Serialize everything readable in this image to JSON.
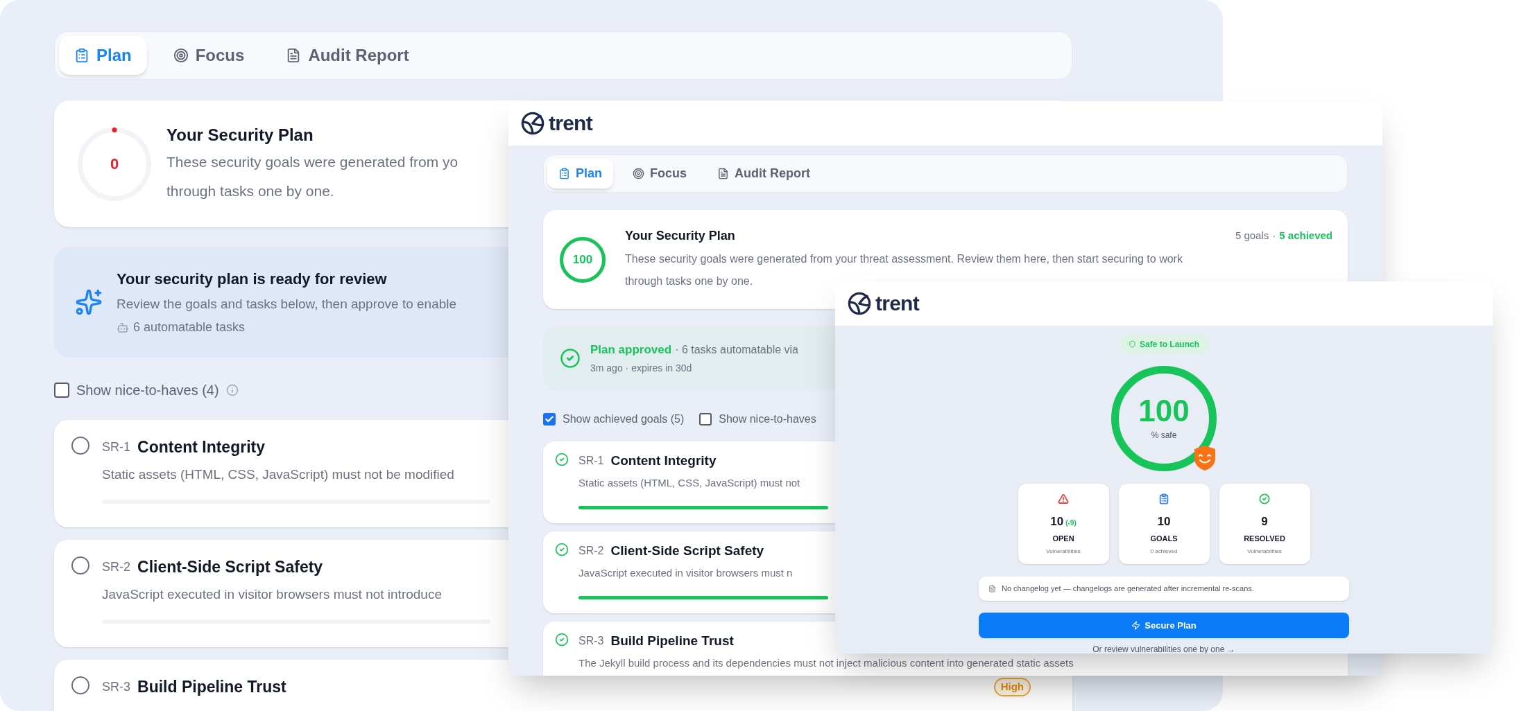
{
  "back_window": {
    "tabs": [
      {
        "label": "Plan",
        "selected": true
      },
      {
        "label": "Focus",
        "selected": false
      },
      {
        "label": "Audit Report",
        "selected": false
      }
    ],
    "plan_card": {
      "score": "0",
      "level": 0,
      "title": "Your Security Plan",
      "description": [
        "These security goals were generated from yo",
        "through tasks one by one."
      ]
    },
    "ready_banner": {
      "title": "Your security plan is ready for review",
      "description": "Review the goals and tasks below, then approve to enable",
      "automatable": "6 automatable tasks"
    },
    "filters": [
      {
        "label": "Show nice-to-haves (4)",
        "checked": false,
        "info": true
      }
    ],
    "goals": [
      {
        "id": "SR-1",
        "title": "Content Integrity",
        "description": "Static assets (HTML, CSS, JavaScript) must not be modified",
        "achieved": false,
        "progress_bar": true
      },
      {
        "id": "SR-2",
        "title": "Client-Side Script Safety",
        "description": "JavaScript executed in visitor browsers must not introduce",
        "achieved": false,
        "progress_bar": true
      },
      {
        "id": "SR-3",
        "title": "Build Pipeline Trust",
        "achieved": false,
        "severity": "High"
      }
    ]
  },
  "middle_window": {
    "logo": "trent",
    "tabs": [
      {
        "label": "Plan",
        "selected": true
      },
      {
        "label": "Focus",
        "selected": false
      },
      {
        "label": "Audit Report",
        "selected": false
      }
    ],
    "plan_card": {
      "score": "100",
      "level": 1,
      "title": "Your Security Plan",
      "goals_count": "5 goals",
      "separator": "·",
      "achieved_count": "5 achieved",
      "description": [
        "These security goals were generated from your threat assessment. Review them here, then start securing to work",
        "through tasks one by one."
      ]
    },
    "approved_banner": {
      "title": "Plan approved",
      "detail": "· 6 tasks automatable via",
      "meta": "3m ago · expires in 30d"
    },
    "filters": [
      {
        "label": "Show achieved goals (5)",
        "checked": true,
        "info": false
      },
      {
        "label": "Show nice-to-haves",
        "checked": false,
        "info": false
      }
    ],
    "goals": [
      {
        "id": "SR-1",
        "title": "Content Integrity",
        "description": "Static assets (HTML, CSS, JavaScript) must not",
        "achieved": true,
        "progress_bar": true
      },
      {
        "id": "SR-2",
        "title": "Client-Side Script Safety",
        "description": "JavaScript executed in visitor browsers must n",
        "achieved": true,
        "progress_bar": true
      },
      {
        "id": "SR-3",
        "title": "Build Pipeline Trust",
        "description": "The Jekyll build process and its dependencies must not inject malicious content into generated static assets",
        "achieved": true
      }
    ]
  },
  "front_window": {
    "logo": "trent",
    "status_badge": "Safe to Launch",
    "score": {
      "value": "100",
      "unit": "% safe",
      "level": 1
    },
    "stats": [
      {
        "value": "10",
        "delta": "(-9)",
        "label": "OPEN",
        "caption": "Vulnerabilities",
        "color": "#ef4444"
      },
      {
        "value": "10",
        "label": "GOALS",
        "caption": "0 achieved",
        "color": "#3b82f6"
      },
      {
        "value": "9",
        "label": "RESOLVED",
        "caption": "Vulnerabilities",
        "color": "#22c55e"
      }
    ],
    "changelog": "No changelog yet — changelogs are generated after incremental re-scans.",
    "primary_button": "Secure Plan",
    "link": "Or review vulnerabilities one by one →"
  }
}
